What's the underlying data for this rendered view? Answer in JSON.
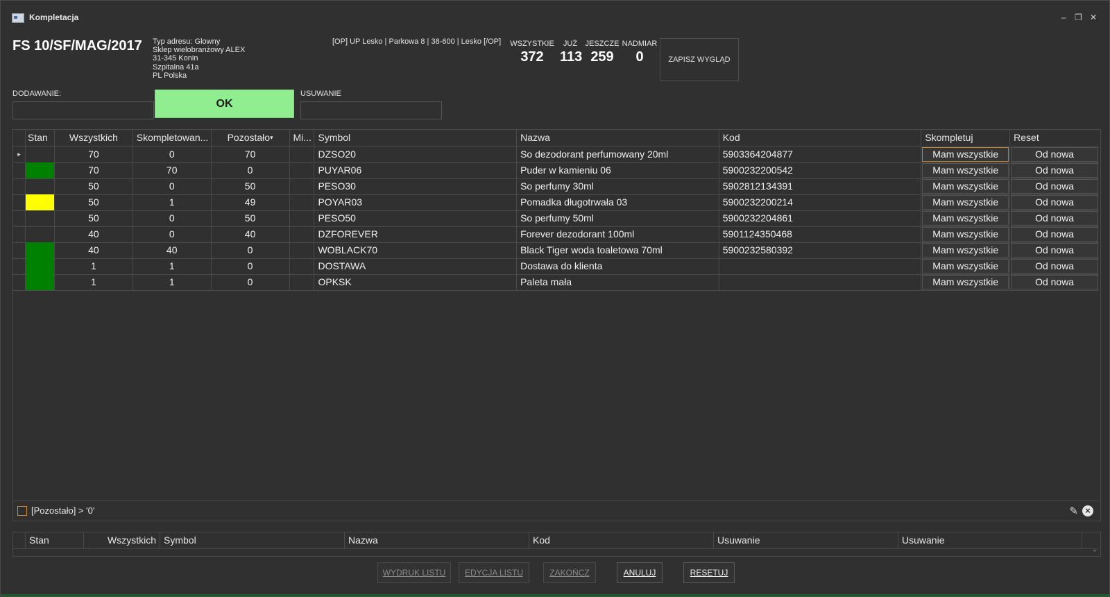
{
  "window": {
    "title": "Kompletacja",
    "controls": {
      "minimize": "–",
      "restore": "❐",
      "close": "✕"
    }
  },
  "header": {
    "doc_number": "FS 10/SF/MAG/2017",
    "address": [
      "Typ adresu: Glowny",
      "Sklep wielobranżowy ALEX",
      "31-345 Konin",
      "Szpitalna 41a",
      "PL Polska"
    ],
    "op_text": "[OP] UP Lesko | Parkowa 8 | 38-600 | Lesko [/OP]",
    "stats": [
      {
        "label": "WSZYSTKIE",
        "value": "372"
      },
      {
        "label": "JUŻ",
        "value": "113"
      },
      {
        "label": "JESZCZE",
        "value": "259"
      },
      {
        "label": "NADMIAR",
        "value": "0"
      }
    ],
    "save_layout_label": "ZAPISZ WYGLĄD"
  },
  "inputs": {
    "add_label": "DODAWANIE:",
    "add_value": "",
    "ok_label": "OK",
    "remove_label": "USUWANIE",
    "remove_value": ""
  },
  "colors": {
    "stan_green": "#008000",
    "stan_yellow": "#ffff00",
    "ok_button": "#90ee90"
  },
  "grid": {
    "columns": [
      "Stan",
      "Wszystkich",
      "Skompletowan...",
      "Pozostało",
      "Mi...",
      "Symbol",
      "Nazwa",
      "Kod",
      "Skompletuj",
      "Reset"
    ],
    "filter_icon": "▾",
    "row_indicator": "▸",
    "rows": [
      {
        "stan": "",
        "all": "70",
        "done": "0",
        "rem": "70",
        "mi": "",
        "sym": "DZSO20",
        "name": "So dezodorant perfumowany 20ml",
        "kod": "5903364204877",
        "sk": "Mam wszystkie",
        "reset": "Od nowa"
      },
      {
        "stan": "green",
        "all": "70",
        "done": "70",
        "rem": "0",
        "mi": "",
        "sym": "PUYAR06",
        "name": "Puder w kamieniu 06",
        "kod": "5900232200542",
        "sk": "Mam wszystkie",
        "reset": "Od nowa"
      },
      {
        "stan": "",
        "all": "50",
        "done": "0",
        "rem": "50",
        "mi": "",
        "sym": "PESO30",
        "name": "So perfumy 30ml",
        "kod": "5902812134391",
        "sk": "Mam wszystkie",
        "reset": "Od nowa"
      },
      {
        "stan": "yellow",
        "all": "50",
        "done": "1",
        "rem": "49",
        "mi": "",
        "sym": "POYAR03",
        "name": "Pomadka długotrwała 03",
        "kod": "5900232200214",
        "sk": "Mam wszystkie",
        "reset": "Od nowa"
      },
      {
        "stan": "",
        "all": "50",
        "done": "0",
        "rem": "50",
        "mi": "",
        "sym": "PESO50",
        "name": "So perfumy 50ml",
        "kod": "5900232204861",
        "sk": "Mam wszystkie",
        "reset": "Od nowa"
      },
      {
        "stan": "",
        "all": "40",
        "done": "0",
        "rem": "40",
        "mi": "",
        "sym": "DZFOREVER",
        "name": "Forever dezodorant 100ml",
        "kod": "5901124350468",
        "sk": "Mam wszystkie",
        "reset": "Od nowa"
      },
      {
        "stan": "green",
        "all": "40",
        "done": "40",
        "rem": "0",
        "mi": "",
        "sym": "WOBLACK70",
        "name": "Black Tiger woda toaletowa 70ml",
        "kod": "5900232580392",
        "sk": "Mam wszystkie",
        "reset": "Od nowa"
      },
      {
        "stan": "green",
        "all": "1",
        "done": "1",
        "rem": "0",
        "mi": "",
        "sym": "DOSTAWA",
        "name": "Dostawa do klienta",
        "kod": "",
        "sk": "Mam wszystkie",
        "reset": "Od nowa"
      },
      {
        "stan": "green",
        "all": "1",
        "done": "1",
        "rem": "0",
        "mi": "",
        "sym": "OPKSK",
        "name": "Paleta mała",
        "kod": "",
        "sk": "Mam wszystkie",
        "reset": "Od nowa"
      }
    ],
    "filter_text": "[Pozostało] > '0'",
    "edit_filter_icon": "✎",
    "clear_filter_icon": "×"
  },
  "grid2": {
    "columns": [
      "Stan",
      "Wszystkich",
      "Symbol",
      "Nazwa",
      "Kod",
      "Usuwanie",
      "Usuwanie"
    ],
    "scroll_glyph": "÷"
  },
  "footer": {
    "buttons": [
      {
        "label": "WYDRUK LISTU",
        "enabled": false
      },
      {
        "label": "EDYCJA LISTU",
        "enabled": false
      },
      {
        "label": "ZAKOŃCZ",
        "enabled": false
      },
      {
        "label": "ANULUJ",
        "enabled": true
      },
      {
        "label": "RESETUJ",
        "enabled": true
      }
    ]
  }
}
